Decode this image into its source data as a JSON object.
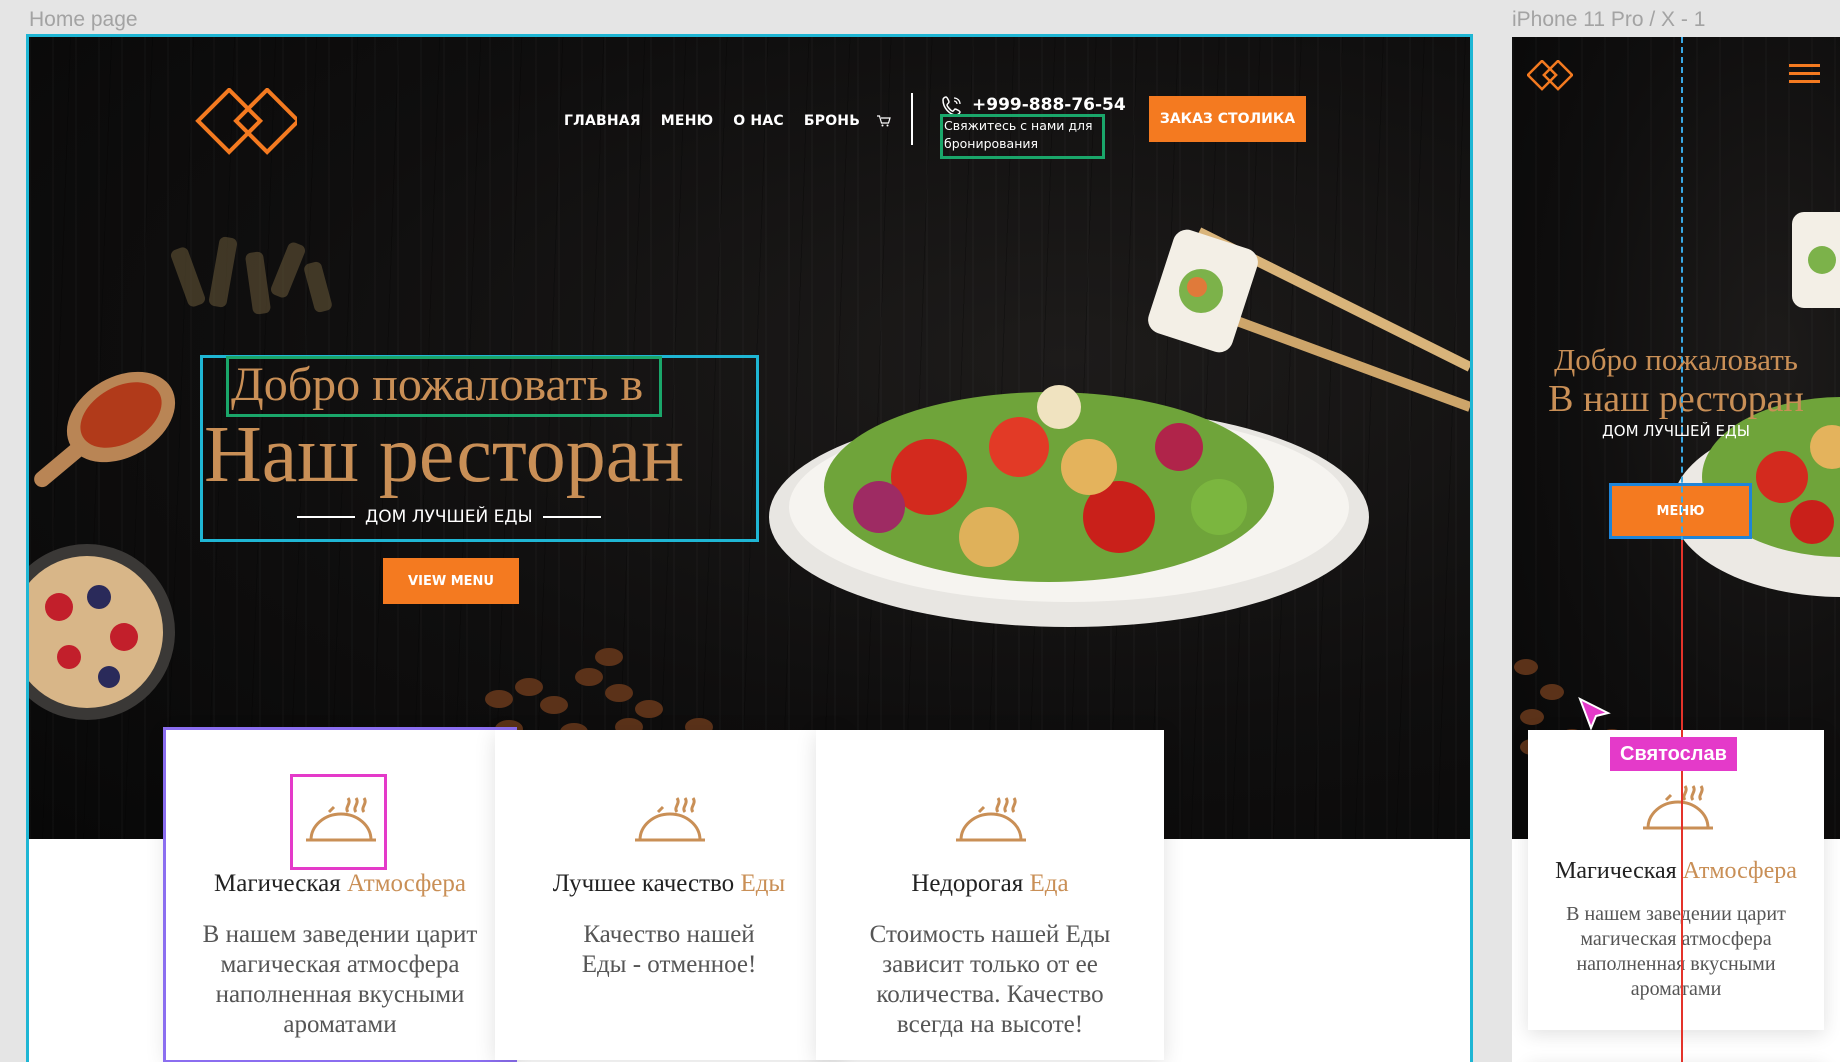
{
  "frames": {
    "desktop_label": "Home page",
    "mobile_label": "iPhone 11 Pro / X - 1"
  },
  "header": {
    "nav": [
      "ГЛАВНАЯ",
      "МЕНЮ",
      "О НАС",
      "БРОНЬ"
    ],
    "phone": "+999-888-76-54",
    "contact_note": "Свяжитесь с нами для бронирования",
    "order_button": "ЗАКАЗ СТОЛИКА"
  },
  "hero": {
    "subtitle": "Добро пожаловать в",
    "title": "Наш ресторан",
    "tagline": "ДОМ ЛУЧШЕЙ ЕДЫ",
    "cta": "VIEW MENU"
  },
  "features": [
    {
      "title_main": "Магическая",
      "title_accent": "Атмосфера",
      "text": "В нашем заведении царит магическая атмосфера наполненная вкусными ароматами"
    },
    {
      "title_main": "Лучшее качество",
      "title_accent": "Еды",
      "text": "Качество нашей Еды - отменное!"
    },
    {
      "title_main": "Недорогая",
      "title_accent": "Еда",
      "text": "Стоимость нашей Еды зависит только от ее количества. Качество всегда на высоте!"
    }
  ],
  "mobile": {
    "subtitle": "Добро пожаловать",
    "title": "В наш ресторан",
    "tagline": "ДОМ ЛУЧШЕЙ ЕДЫ",
    "menu_button": "МЕНЮ",
    "card": {
      "title_main": "Магическая",
      "title_accent": "Атмосфера",
      "text": "В нашем заведении царит магическая атмосфера наполненная вкусными ароматами"
    }
  },
  "collaborator": {
    "name": "Святослав",
    "color": "#e43ac9"
  },
  "colors": {
    "accent": "#f47a20",
    "gold": "#c98f56",
    "selection": "#1fb6d4"
  },
  "icons": {
    "logo": "diamond-logo-icon",
    "cart": "cart-icon",
    "phone": "phone-icon",
    "cloche": "cloche-icon",
    "menu": "hamburger-icon"
  }
}
